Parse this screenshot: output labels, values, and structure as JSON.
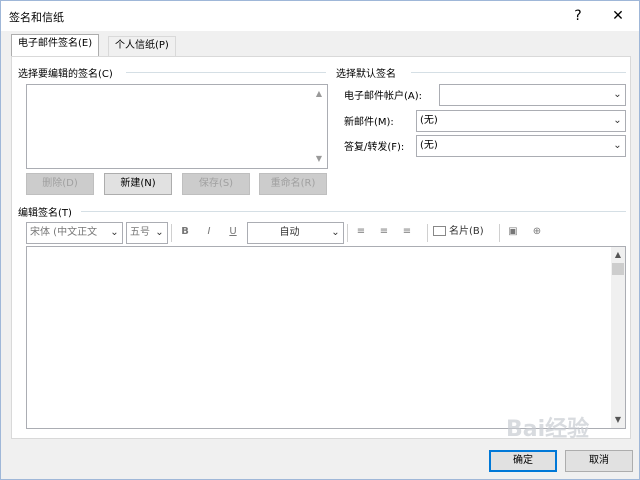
{
  "window": {
    "title": "签名和信纸",
    "help_label": "?",
    "close_label": "✕"
  },
  "tabs": [
    {
      "label": "电子邮件签名(E)",
      "active": true
    },
    {
      "label": "个人信纸(P)",
      "active": false
    }
  ],
  "select_signature": {
    "group_label": "选择要编辑的签名(C)",
    "scroll_up": "▲",
    "scroll_down": "▼"
  },
  "default_signature": {
    "group_label": "选择默认签名",
    "email_account_label": "电子邮件帐户(A):",
    "email_account_value": "",
    "new_messages_label": "新邮件(M):",
    "new_messages_value": "(无)",
    "replies_label": "答复/转发(F):",
    "replies_value": "(无)"
  },
  "signature_buttons": {
    "delete": "删除(D)",
    "new": "新建(N)",
    "save": "保存(S)",
    "rename": "重命名(R)"
  },
  "edit_signature": {
    "group_label": "编辑签名(T)",
    "font_value": "宋体 (中文正文",
    "size_value": "五号",
    "bold": "B",
    "italic": "I",
    "underline": "U",
    "color_value": "自动",
    "business_card": "名片(B)"
  },
  "footer": {
    "ok": "确定",
    "cancel": "取消"
  },
  "watermark_text": "Bai经验"
}
